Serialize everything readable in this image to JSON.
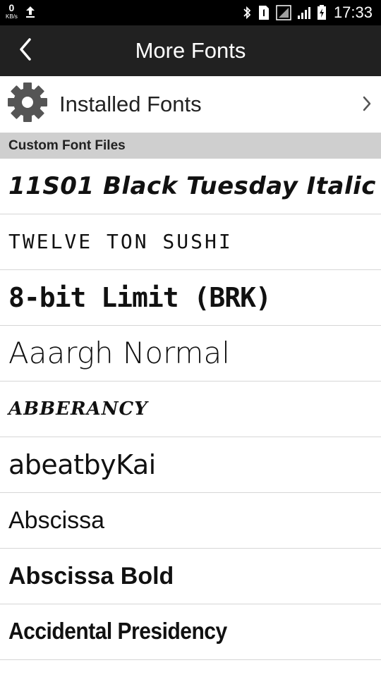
{
  "status_bar": {
    "net_speed_value": "0",
    "net_speed_unit": "KB/s",
    "time": "17:33",
    "icons": [
      "upload-icon",
      "bluetooth-icon",
      "sim-1-icon",
      "signal-icon",
      "signal-icon",
      "battery-icon"
    ]
  },
  "toolbar": {
    "title": "More Fonts",
    "back_icon": "chevron-left-icon"
  },
  "installed": {
    "label": "Installed Fonts",
    "icon": "gear-icon",
    "chevron": "chevron-right-icon"
  },
  "section": {
    "header": "Custom Font Files"
  },
  "fonts": [
    {
      "label": "11S01 Black Tuesday Italic"
    },
    {
      "label": "TWELVE TON SUSHI"
    },
    {
      "label": "8-bit Limit (BRK)"
    },
    {
      "label": "Aaargh Normal"
    },
    {
      "label": "Abberancy"
    },
    {
      "label": "abeatbyKai"
    },
    {
      "label": "Abscissa"
    },
    {
      "label": "Abscissa Bold"
    },
    {
      "label": "Accidental Presidency"
    }
  ],
  "colors": {
    "status_bar": "#000000",
    "toolbar": "#212121",
    "section_header": "#cfcfcf",
    "gear": "#555555",
    "divider": "#d6d6d6"
  }
}
